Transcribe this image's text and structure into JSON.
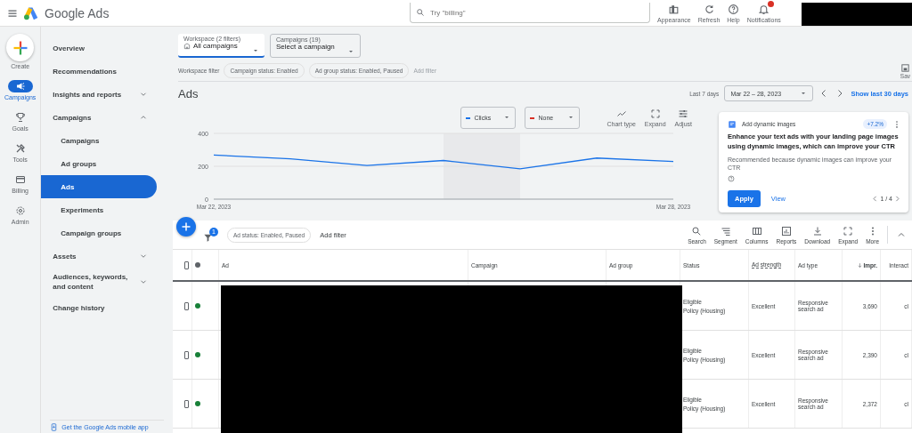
{
  "header": {
    "app_name": "Google Ads",
    "search": {
      "placeholder": "Try \"billing\""
    },
    "actions": [
      {
        "label": "Appearance",
        "kind": "appearance",
        "badge": false
      },
      {
        "label": "Refresh",
        "kind": "refresh",
        "badge": false
      },
      {
        "label": "Help",
        "kind": "help",
        "badge": false
      },
      {
        "label": "Notifications",
        "kind": "notifications",
        "badge": true
      }
    ]
  },
  "rail": [
    {
      "label": "Create",
      "kind": "create",
      "selected": false
    },
    {
      "label": "Campaigns",
      "kind": "campaigns",
      "selected": true
    },
    {
      "label": "Goals",
      "kind": "goals",
      "selected": false
    },
    {
      "label": "Tools",
      "kind": "tools",
      "selected": false
    },
    {
      "label": "Billing",
      "kind": "billing",
      "selected": false
    },
    {
      "label": "Admin",
      "kind": "admin",
      "selected": false
    }
  ],
  "nav": [
    {
      "label": "Overview",
      "selected": false
    },
    {
      "label": "Recommendations",
      "selected": false
    },
    {
      "label": "Insights and reports",
      "selected": false,
      "expanded": false
    },
    {
      "label": "Campaigns",
      "selected": false,
      "expanded": true,
      "children": [
        {
          "label": "Campaigns",
          "selected": false
        },
        {
          "label": "Ad groups",
          "selected": false
        },
        {
          "label": "Ads",
          "selected": true
        },
        {
          "label": "Experiments",
          "selected": false
        },
        {
          "label": "Campaign groups",
          "selected": false
        }
      ]
    },
    {
      "label": "Assets",
      "selected": false,
      "expanded": false
    },
    {
      "label": "Audiences, keywords, and content",
      "selected": false,
      "expanded": false
    },
    {
      "label": "Change history",
      "selected": false
    }
  ],
  "mobile_app_link": "Get the Google Ads mobile app",
  "workspace": {
    "label": "Workspace (2 filters)",
    "value": "All campaigns"
  },
  "campaign_picker": {
    "label": "Campaigns (19)",
    "value": "Select a campaign"
  },
  "workspace_filter": {
    "label": "Workspace filter",
    "chips": [
      "Campaign status: Enabled",
      "Ad group status: Enabled, Paused"
    ],
    "add_filter": "Add filter",
    "save": "Sav"
  },
  "page_title": "Ads",
  "date": {
    "preset": "Last 7 days",
    "range": "Mar 22 – 28, 2023",
    "link": "Show last 30 days"
  },
  "chart_controls": {
    "metrics": [
      {
        "label": "Clicks",
        "color": "#1a73e8"
      },
      {
        "label": "None",
        "color": "#d93025"
      }
    ],
    "tools": [
      {
        "label": "Chart type",
        "kind": "chart"
      },
      {
        "label": "Expand",
        "kind": "expand"
      },
      {
        "label": "Adjust",
        "kind": "adjust"
      }
    ]
  },
  "chart_data": {
    "type": "line",
    "categories": [
      "Mar 22, 2023",
      null,
      null,
      null,
      null,
      null,
      "Mar 28, 2023"
    ],
    "yticks": [
      0,
      200,
      400
    ],
    "ylim": [
      0,
      400
    ],
    "series": [
      {
        "color": "#1a73e8",
        "values": [
          268,
          245,
          205,
          235,
          185,
          250,
          229
        ]
      }
    ]
  },
  "recommendation": {
    "title": "Add dynamic images",
    "uplift": "+7.2%",
    "headline": "Enhance your text ads with your landing page images using dynamic images, which can improve your CTR",
    "reason": "Recommended because dynamic images can improve your CTR",
    "apply": "Apply",
    "view": "View",
    "pager": "1 / 4"
  },
  "table_toolbar": {
    "filter_count": "1",
    "chips": [
      "Ad status: Enabled, Paused"
    ],
    "add_filter": "Add filter",
    "actions": [
      {
        "label": "Search",
        "kind": "search"
      },
      {
        "label": "Segment",
        "kind": "segment"
      },
      {
        "label": "Columns",
        "kind": "columns"
      },
      {
        "label": "Reports",
        "kind": "reports"
      },
      {
        "label": "Download",
        "kind": "download"
      },
      {
        "label": "Expand",
        "kind": "expand"
      },
      {
        "label": "More",
        "kind": "more"
      }
    ]
  },
  "table": {
    "all_checked": false,
    "columns": [
      {
        "label": "Ad",
        "sorted": false
      },
      {
        "label": "Campaign",
        "sorted": false
      },
      {
        "label": "Ad group",
        "sorted": false
      },
      {
        "label": "Status",
        "sorted": false
      },
      {
        "label": "Ad strength",
        "sorted": false
      },
      {
        "label": "Ad type",
        "sorted": false
      },
      {
        "label": "Impr.",
        "sorted": true
      },
      {
        "label": "Interact",
        "sorted": false
      }
    ],
    "rows": [
      {
        "checked": false,
        "color": "#188038",
        "status": "Eligible",
        "policy": "Policy (Housing)",
        "ad_strength": "Excellent",
        "ad_type": "Responsive search ad",
        "impressions": "3,690",
        "interactions": "cl"
      },
      {
        "checked": false,
        "color": "#188038",
        "status": "Eligible",
        "policy": "Policy (Housing)",
        "ad_strength": "Excellent",
        "ad_type": "Responsive search ad",
        "impressions": "2,390",
        "interactions": "cl"
      },
      {
        "checked": false,
        "color": "#188038",
        "status": "Eligible",
        "policy": "Policy (Housing)",
        "ad_strength": "Excellent",
        "ad_type": "Responsive search ad",
        "impressions": "2,372",
        "interactions": "cl"
      }
    ]
  }
}
